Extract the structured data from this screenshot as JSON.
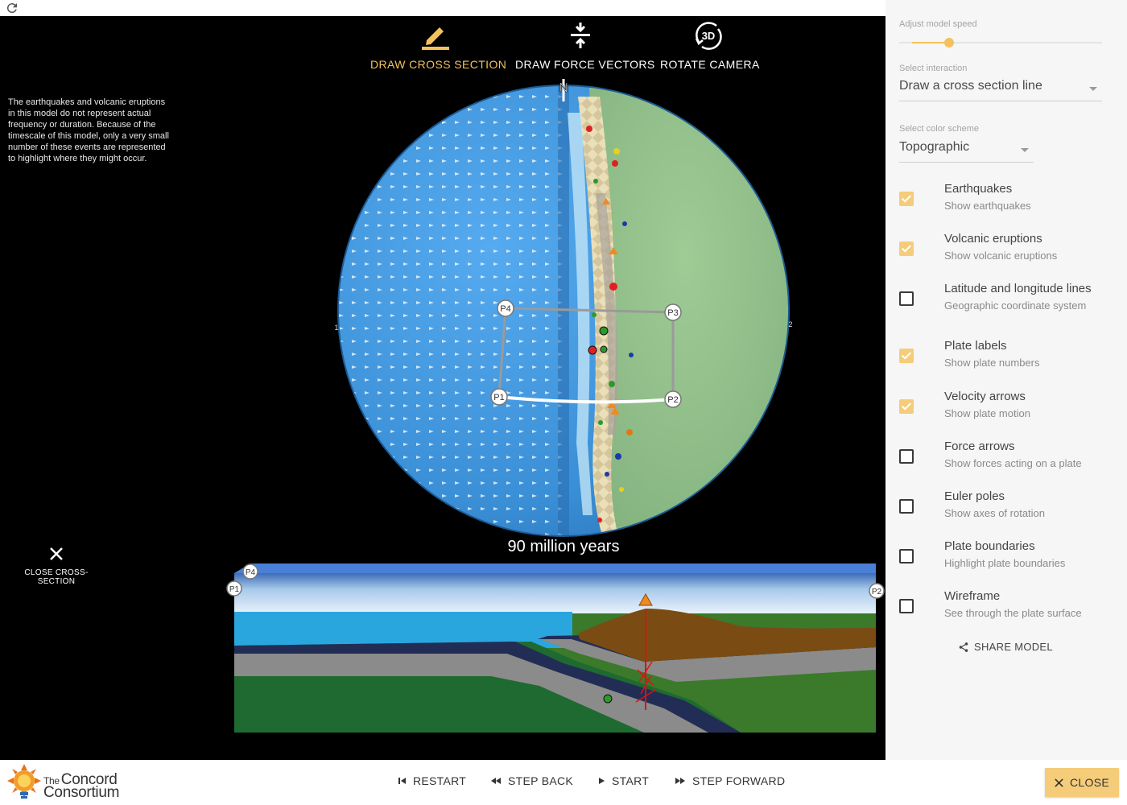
{
  "toolbar": {
    "draw_cross_section": "DRAW CROSS SECTION",
    "draw_force_vectors": "DRAW FORCE VECTORS",
    "rotate_camera": "ROTATE CAMERA",
    "rotate_badge": "3D",
    "active_color": "#f4c15d"
  },
  "disclaimer": "The earthquakes and volcanic eruptions in this model do not represent actual frequency or duration. Because of the timescale of this model, only a very small number of these events are represented to highlight where they might occur.",
  "globe": {
    "north_label": "N",
    "side_label_left": "1",
    "side_label_right": "2",
    "points": {
      "p1": "P1",
      "p2": "P2",
      "p3": "P3",
      "p4": "P4"
    },
    "ocean_color": "#3a8fd6",
    "continent_color": "#8fbf8a"
  },
  "time_label": "90 million years",
  "close_cross_section": "CLOSE CROSS-SECTION",
  "cross_section": {
    "labels": {
      "p1": "P1",
      "p2": "P2",
      "p4": "P4"
    }
  },
  "panel": {
    "speed_label": "Adjust model speed",
    "speed_fraction": 0.2,
    "interaction_label": "Select interaction",
    "interaction_value": "Draw a cross section line",
    "color_scheme_label": "Select color scheme",
    "color_scheme_value": "Topographic",
    "options": [
      {
        "title": "Earthquakes",
        "subtitle": "Show earthquakes",
        "checked": true
      },
      {
        "title": "Volcanic eruptions",
        "subtitle": "Show volcanic eruptions",
        "checked": true
      },
      {
        "title": "Latitude and longitude lines",
        "subtitle": "Geographic coordinate system",
        "checked": false
      },
      {
        "title": "Plate labels",
        "subtitle": "Show plate numbers",
        "checked": true
      },
      {
        "title": "Velocity arrows",
        "subtitle": "Show plate motion",
        "checked": true
      },
      {
        "title": "Force arrows",
        "subtitle": "Show forces acting on a plate",
        "checked": false
      },
      {
        "title": "Euler poles",
        "subtitle": "Show axes of rotation",
        "checked": false
      },
      {
        "title": "Plate boundaries",
        "subtitle": "Highlight plate boundaries",
        "checked": false
      },
      {
        "title": "Wireframe",
        "subtitle": "See through the plate surface",
        "checked": false
      }
    ],
    "share": "SHARE MODEL"
  },
  "bottom": {
    "logo_the": "The",
    "logo_line1": "Concord",
    "logo_line2": "Consortium",
    "restart": "RESTART",
    "step_back": "STEP BACK",
    "start": "START",
    "step_forward": "STEP FORWARD",
    "close": "CLOSE"
  }
}
